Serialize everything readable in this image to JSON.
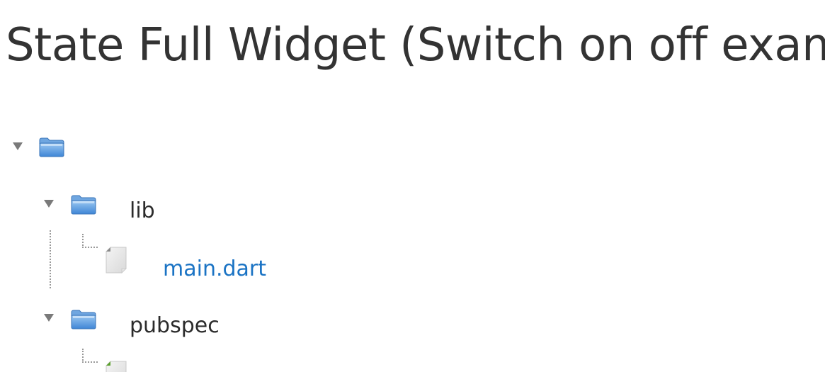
{
  "page": {
    "title": "State Full Widget (Switch on off exam"
  },
  "tree": {
    "root": {
      "label": "",
      "children": [
        {
          "label": "lib",
          "children": [
            {
              "label": "main.dart",
              "type": "file",
              "link": true
            }
          ]
        },
        {
          "label": "pubspec",
          "children": [
            {
              "label": "",
              "type": "file",
              "link": false
            }
          ]
        }
      ]
    }
  },
  "icons": {
    "toggle": "triangle-down-icon",
    "folder": "folder-icon",
    "file": "file-icon"
  },
  "colors": {
    "title": "#333333",
    "text": "#2b2b2b",
    "link": "#1a73c4",
    "folder_blue": "#5b9ee0",
    "toggle_gray": "#7a7a7a"
  }
}
